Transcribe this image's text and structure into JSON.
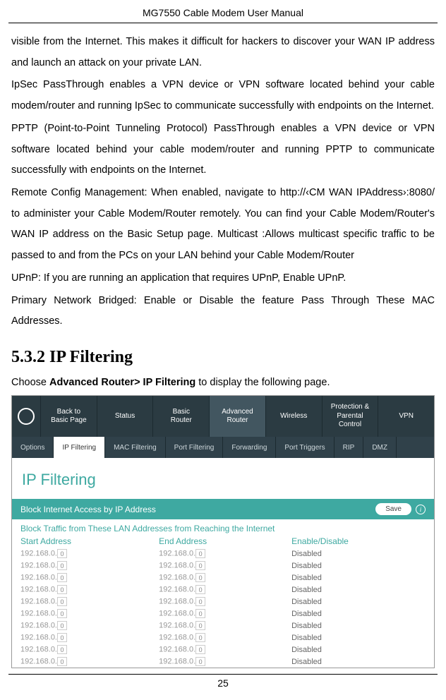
{
  "header": "MG7550 Cable Modem User Manual",
  "paragraphs": {
    "p1": "visible from the Internet. This makes it difficult for hackers to discover your WAN IP address and launch an attack on your private LAN.",
    "p2": "IpSec PassThrough enables a VPN device or VPN software located behind your cable modem/router and running IpSec to communicate successfully with endpoints on the Internet.",
    "p3": "PPTP (Point-to-Point Tunneling Protocol) PassThrough enables a VPN device or VPN software located behind your cable modem/router and running PPTP to communicate successfully with endpoints on the Internet.",
    "p4": "Remote Config Management: When enabled, navigate to http://‹CM WAN IPAddress›:8080/ to administer your Cable Modem/Router remotely. You can find your Cable Modem/Router's WAN IP address on the Basic Setup page. Multicast :Allows multicast specific traffic to be passed to and from the PCs on your LAN behind your Cable Modem/Router",
    "p5": "UPnP: If you are running an application that requires UPnP, Enable UPnP.",
    "p6": "Primary Network Bridged: Enable or Disable the feature Pass Through These MAC Addresses."
  },
  "section_heading": "5.3.2   IP Filtering",
  "instruction_pre": "Choose ",
  "instruction_bold": "Advanced Router> IP Filtering",
  "instruction_post": " to display the following page.",
  "ui": {
    "tabs": {
      "t0": "Back to\nBasic Page",
      "t1": "Status",
      "t2": "Basic\nRouter",
      "t3": "Advanced\nRouter",
      "t4": "Wireless",
      "t5": "Protection &\nParental Control",
      "t6": "VPN"
    },
    "subtabs": {
      "s0": "Options",
      "s1": "IP Filtering",
      "s2": "MAC Filtering",
      "s3": "Port Filtering",
      "s4": "Forwarding",
      "s5": "Port Triggers",
      "s6": "RIP",
      "s7": "DMZ"
    },
    "panel_heading": "IP Filtering",
    "block_title": "Block Internet Access by IP Address",
    "save_label": "Save",
    "block_subtitle": "Block Traffic from These LAN Addresses from Reaching the Internet",
    "col_start": "Start Address",
    "col_end": "End Address",
    "col_enable": "Enable/Disable",
    "ip_prefix": "192.168.0.",
    "ip_oct": "0",
    "status": "Disabled",
    "row_count": 10
  },
  "page_number": "25"
}
